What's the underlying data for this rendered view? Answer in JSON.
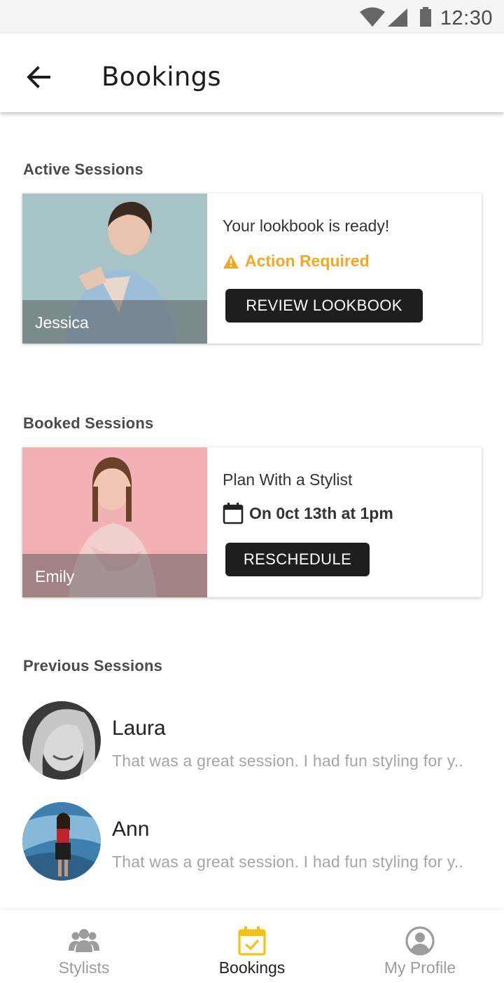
{
  "status_bar": {
    "time": "12:30"
  },
  "header": {
    "title": "Bookings"
  },
  "active": {
    "section_title": "Active Sessions",
    "stylist_name": "Jessica",
    "heading": "Your lookbook is ready!",
    "status": "Action Required",
    "status_color": "#f5a623",
    "button_label": "REVIEW LOOKBOOK"
  },
  "booked": {
    "section_title": "Booked Sessions",
    "stylist_name": "Emily",
    "heading": "Plan With a Stylist",
    "date_text": "On 0ct 13th at 1pm",
    "button_label": "RESCHEDULE"
  },
  "previous": {
    "section_title": "Previous Sessions",
    "items": [
      {
        "name": "Laura",
        "message": "That was a great session. I had fun styling for y.."
      },
      {
        "name": "Ann",
        "message": "That was a great session. I had fun styling for y.."
      }
    ]
  },
  "nav": {
    "items": [
      {
        "label": "Stylists",
        "icon": "group-icon"
      },
      {
        "label": "Bookings",
        "icon": "calendar-check-icon"
      },
      {
        "label": "My Profile",
        "icon": "account-circle-icon"
      }
    ],
    "active_color": "#f2c314",
    "inactive_color": "#9c9c9c"
  }
}
